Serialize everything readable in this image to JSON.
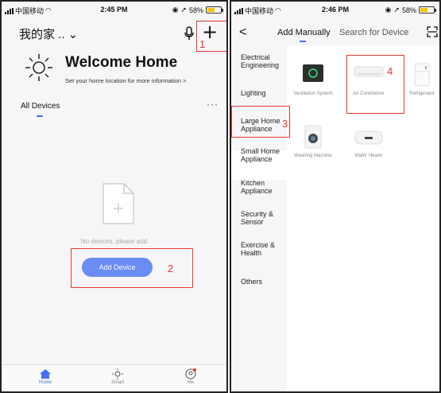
{
  "status_left": {
    "carrier": "中国移动",
    "time": "2:45 PM",
    "battery": "58%",
    "battery_level": 0.58
  },
  "status_right": {
    "carrier": "中国移动",
    "time": "2:46 PM",
    "battery": "58%",
    "battery_level": 0.58
  },
  "home": {
    "home_name": "我的家 .. ⌄",
    "welcome_title": "Welcome Home",
    "welcome_subtitle": "Set your home location for more information  >",
    "section_title": "All Devices",
    "more": "···",
    "empty_text": "No devices, please add",
    "add_device_label": "Add Device"
  },
  "bottom_tabs": [
    {
      "label": "Home"
    },
    {
      "label": "Smart"
    },
    {
      "label": "Me"
    }
  ],
  "add_page": {
    "back": "<",
    "tab_manual": "Add Manually",
    "tab_search": "Search for Device",
    "categories": [
      "Electrical Engineering",
      "Lighting",
      "Large Home Appliance",
      "Small Home Appliance",
      "Kitchen Appliance",
      "Security & Sensor",
      "Exercise & Health",
      "Others"
    ],
    "devices": [
      {
        "name": "Ventilation System"
      },
      {
        "name": "Air Conditioner"
      },
      {
        "name": "Refrigerator"
      },
      {
        "name": "Washing Machine"
      },
      {
        "name": "Water Heater"
      }
    ]
  },
  "annotations": [
    "1",
    "2",
    "3",
    "4"
  ],
  "colors": {
    "accent": "#6a8cf4",
    "annotation": "#e53935",
    "battery": "#f5c400"
  }
}
